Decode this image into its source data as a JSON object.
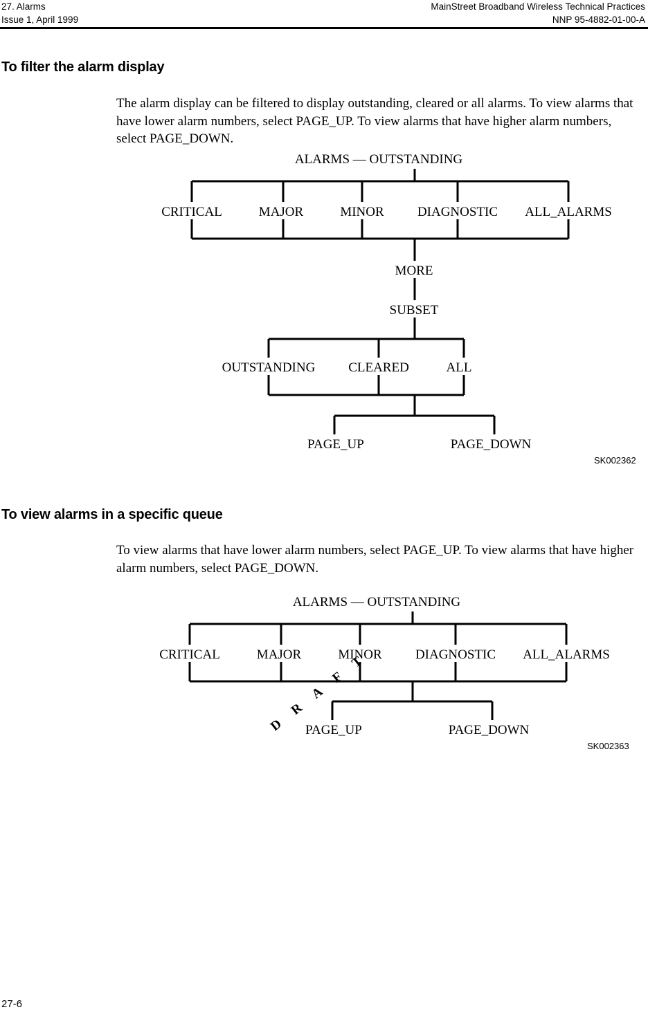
{
  "header": {
    "left_line1": "27. Alarms",
    "left_line2": "Issue 1, April 1999",
    "right_line1": "MainStreet Broadband Wireless Technical Practices",
    "right_line2": "NNP 95-4882-01-00-A"
  },
  "watermark": {
    "text": "DRAFT",
    "color": "#EFEFEF"
  },
  "sections": [
    {
      "heading": "To filter the alarm display",
      "paragraph": "The alarm display can be filtered to display outstanding, cleared or all alarms. To view alarms that have lower alarm numbers, select PAGE_UP. To view alarms that have higher alarm numbers, select PAGE_DOWN.",
      "figure_id": "SK002362"
    },
    {
      "heading": "To view alarms in a specific queue",
      "paragraph": "To view alarms that have lower alarm numbers, select PAGE_UP. To view alarms that have higher alarm numbers, select PAGE_DOWN.",
      "figure_id": "SK002363"
    }
  ],
  "figure1": {
    "root": "ALARMS — OUTSTANDING",
    "level1": [
      "CRITICAL",
      "MAJOR",
      "MINOR",
      "DIAGNOSTIC",
      "ALL_ALARMS"
    ],
    "more": "MORE",
    "subset": "SUBSET",
    "level2": [
      "OUTSTANDING",
      "CLEARED",
      "ALL"
    ],
    "level3": [
      "PAGE_UP",
      "PAGE_DOWN"
    ]
  },
  "figure2": {
    "root": "ALARMS — OUTSTANDING",
    "level1": [
      "CRITICAL",
      "MAJOR",
      "MINOR",
      "DIAGNOSTIC",
      "ALL_ALARMS"
    ],
    "level2": [
      "PAGE_UP",
      "PAGE_DOWN"
    ]
  },
  "footer": {
    "page_number": "27-6"
  }
}
